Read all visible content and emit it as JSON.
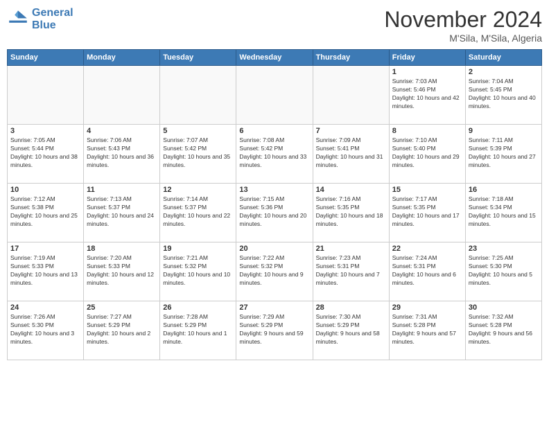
{
  "header": {
    "logo_line1": "General",
    "logo_line2": "Blue",
    "month": "November 2024",
    "location": "M'Sila, M'Sila, Algeria"
  },
  "weekdays": [
    "Sunday",
    "Monday",
    "Tuesday",
    "Wednesday",
    "Thursday",
    "Friday",
    "Saturday"
  ],
  "weeks": [
    [
      {
        "day": "",
        "info": ""
      },
      {
        "day": "",
        "info": ""
      },
      {
        "day": "",
        "info": ""
      },
      {
        "day": "",
        "info": ""
      },
      {
        "day": "",
        "info": ""
      },
      {
        "day": "1",
        "info": "Sunrise: 7:03 AM\nSunset: 5:46 PM\nDaylight: 10 hours and 42 minutes."
      },
      {
        "day": "2",
        "info": "Sunrise: 7:04 AM\nSunset: 5:45 PM\nDaylight: 10 hours and 40 minutes."
      }
    ],
    [
      {
        "day": "3",
        "info": "Sunrise: 7:05 AM\nSunset: 5:44 PM\nDaylight: 10 hours and 38 minutes."
      },
      {
        "day": "4",
        "info": "Sunrise: 7:06 AM\nSunset: 5:43 PM\nDaylight: 10 hours and 36 minutes."
      },
      {
        "day": "5",
        "info": "Sunrise: 7:07 AM\nSunset: 5:42 PM\nDaylight: 10 hours and 35 minutes."
      },
      {
        "day": "6",
        "info": "Sunrise: 7:08 AM\nSunset: 5:42 PM\nDaylight: 10 hours and 33 minutes."
      },
      {
        "day": "7",
        "info": "Sunrise: 7:09 AM\nSunset: 5:41 PM\nDaylight: 10 hours and 31 minutes."
      },
      {
        "day": "8",
        "info": "Sunrise: 7:10 AM\nSunset: 5:40 PM\nDaylight: 10 hours and 29 minutes."
      },
      {
        "day": "9",
        "info": "Sunrise: 7:11 AM\nSunset: 5:39 PM\nDaylight: 10 hours and 27 minutes."
      }
    ],
    [
      {
        "day": "10",
        "info": "Sunrise: 7:12 AM\nSunset: 5:38 PM\nDaylight: 10 hours and 25 minutes."
      },
      {
        "day": "11",
        "info": "Sunrise: 7:13 AM\nSunset: 5:37 PM\nDaylight: 10 hours and 24 minutes."
      },
      {
        "day": "12",
        "info": "Sunrise: 7:14 AM\nSunset: 5:37 PM\nDaylight: 10 hours and 22 minutes."
      },
      {
        "day": "13",
        "info": "Sunrise: 7:15 AM\nSunset: 5:36 PM\nDaylight: 10 hours and 20 minutes."
      },
      {
        "day": "14",
        "info": "Sunrise: 7:16 AM\nSunset: 5:35 PM\nDaylight: 10 hours and 18 minutes."
      },
      {
        "day": "15",
        "info": "Sunrise: 7:17 AM\nSunset: 5:35 PM\nDaylight: 10 hours and 17 minutes."
      },
      {
        "day": "16",
        "info": "Sunrise: 7:18 AM\nSunset: 5:34 PM\nDaylight: 10 hours and 15 minutes."
      }
    ],
    [
      {
        "day": "17",
        "info": "Sunrise: 7:19 AM\nSunset: 5:33 PM\nDaylight: 10 hours and 13 minutes."
      },
      {
        "day": "18",
        "info": "Sunrise: 7:20 AM\nSunset: 5:33 PM\nDaylight: 10 hours and 12 minutes."
      },
      {
        "day": "19",
        "info": "Sunrise: 7:21 AM\nSunset: 5:32 PM\nDaylight: 10 hours and 10 minutes."
      },
      {
        "day": "20",
        "info": "Sunrise: 7:22 AM\nSunset: 5:32 PM\nDaylight: 10 hours and 9 minutes."
      },
      {
        "day": "21",
        "info": "Sunrise: 7:23 AM\nSunset: 5:31 PM\nDaylight: 10 hours and 7 minutes."
      },
      {
        "day": "22",
        "info": "Sunrise: 7:24 AM\nSunset: 5:31 PM\nDaylight: 10 hours and 6 minutes."
      },
      {
        "day": "23",
        "info": "Sunrise: 7:25 AM\nSunset: 5:30 PM\nDaylight: 10 hours and 5 minutes."
      }
    ],
    [
      {
        "day": "24",
        "info": "Sunrise: 7:26 AM\nSunset: 5:30 PM\nDaylight: 10 hours and 3 minutes."
      },
      {
        "day": "25",
        "info": "Sunrise: 7:27 AM\nSunset: 5:29 PM\nDaylight: 10 hours and 2 minutes."
      },
      {
        "day": "26",
        "info": "Sunrise: 7:28 AM\nSunset: 5:29 PM\nDaylight: 10 hours and 1 minute."
      },
      {
        "day": "27",
        "info": "Sunrise: 7:29 AM\nSunset: 5:29 PM\nDaylight: 9 hours and 59 minutes."
      },
      {
        "day": "28",
        "info": "Sunrise: 7:30 AM\nSunset: 5:29 PM\nDaylight: 9 hours and 58 minutes."
      },
      {
        "day": "29",
        "info": "Sunrise: 7:31 AM\nSunset: 5:28 PM\nDaylight: 9 hours and 57 minutes."
      },
      {
        "day": "30",
        "info": "Sunrise: 7:32 AM\nSunset: 5:28 PM\nDaylight: 9 hours and 56 minutes."
      }
    ]
  ]
}
